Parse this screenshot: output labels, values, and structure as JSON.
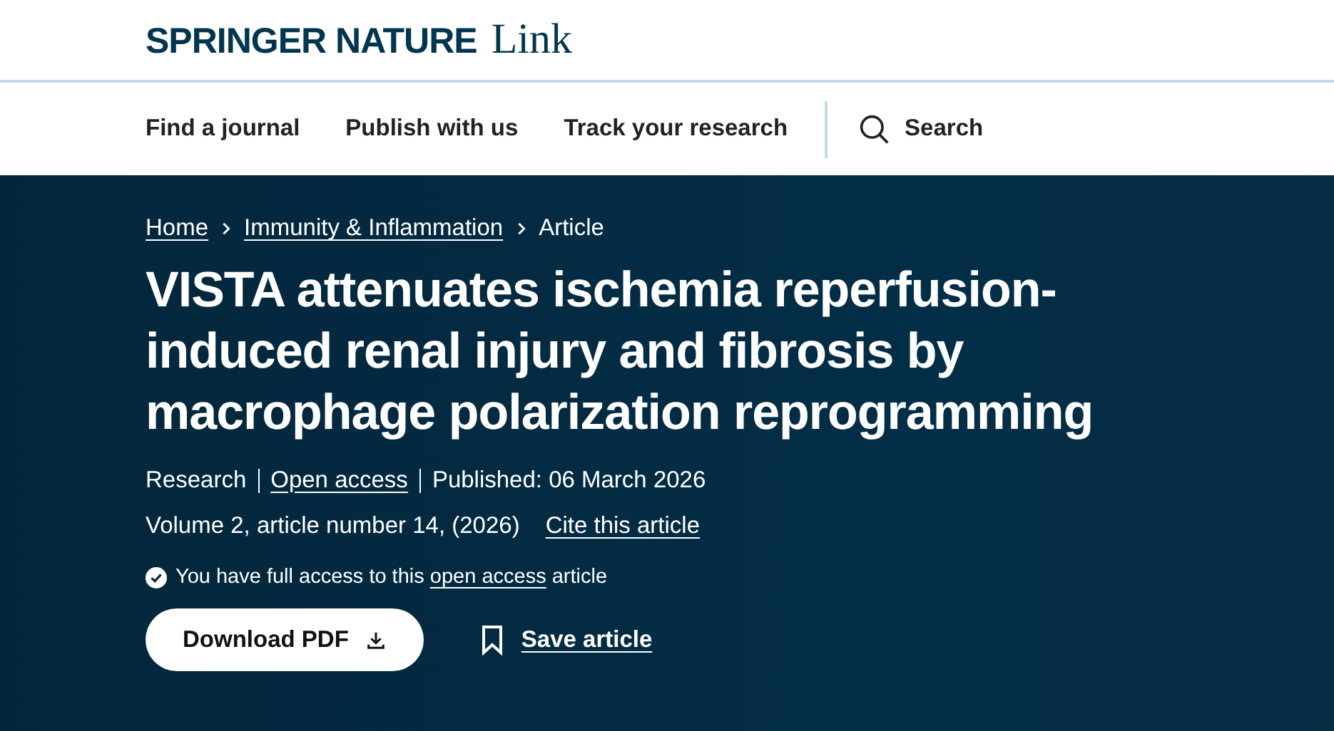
{
  "brand": {
    "name": "SPRINGER NATURE",
    "product": "Link"
  },
  "nav": {
    "items": [
      "Find a journal",
      "Publish with us",
      "Track your research"
    ],
    "search": "Search"
  },
  "breadcrumbs": [
    {
      "label": "Home",
      "link": true
    },
    {
      "label": "Immunity & Inflammation",
      "link": true
    },
    {
      "label": "Article",
      "link": false
    }
  ],
  "title": "VISTA attenuates ischemia reperfusion-induced renal injury and fibrosis by macrophage polarization reprogramming",
  "meta": [
    {
      "label": "Research",
      "link": false
    },
    {
      "label": "Open access",
      "link": true
    },
    {
      "label": "Published: 06 March 2026",
      "link": false
    }
  ],
  "citation": {
    "text": "Volume 2, article number 14, (2026)",
    "cite_link": "Cite this article"
  },
  "access": {
    "before": "You have full access to this",
    "link": "open access",
    "after": "article"
  },
  "actions": {
    "download": "Download PDF",
    "save": "Save article"
  }
}
